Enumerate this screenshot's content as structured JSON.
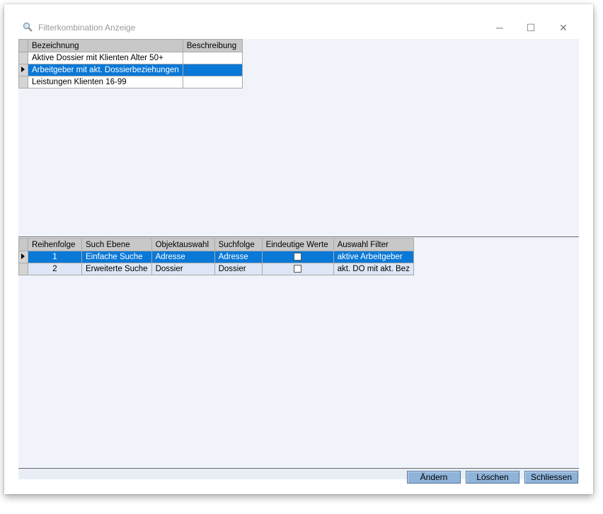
{
  "window": {
    "title": "Filterkombination Anzeige",
    "min_glyph": "─",
    "max_glyph": "☐",
    "close_glyph": "✕"
  },
  "grid1": {
    "headers": [
      "Bezeichnung",
      "Beschreibung"
    ],
    "rows": [
      {
        "bezeichnung": "Aktive Dossier mit Klienten Alter 50+",
        "beschreibung": ""
      },
      {
        "bezeichnung": "Arbeitgeber mit akt. Dossierbeziehungen",
        "beschreibung": ""
      },
      {
        "bezeichnung": "Leistungen Klienten 16-99",
        "beschreibung": ""
      }
    ]
  },
  "grid2": {
    "headers": [
      "Reihenfolge",
      "Such Ebene",
      "Objektauswahl",
      "Suchfolge",
      "Eindeutige Werte",
      "Auswahl Filter"
    ],
    "rows": [
      {
        "reihenfolge": "1",
        "such_ebene": "Einfache Suche",
        "objektauswahl": "Adresse",
        "suchfolge": "Adresse",
        "eindeutige_werte": false,
        "auswahl_filter": "aktive Arbeitgeber"
      },
      {
        "reihenfolge": "2",
        "such_ebene": "Erweiterte Suche",
        "objektauswahl": "Dossier",
        "suchfolge": "Dossier",
        "eindeutige_werte": false,
        "auswahl_filter": "akt. DO mit akt. Bez"
      }
    ]
  },
  "buttons": {
    "aendern": "Ändern",
    "loeschen": "Löschen",
    "schliessen": "Schliessen"
  },
  "colors": {
    "selection": "#0a78d7",
    "button": "#8fb3d9",
    "background": "#f0f3fa"
  }
}
